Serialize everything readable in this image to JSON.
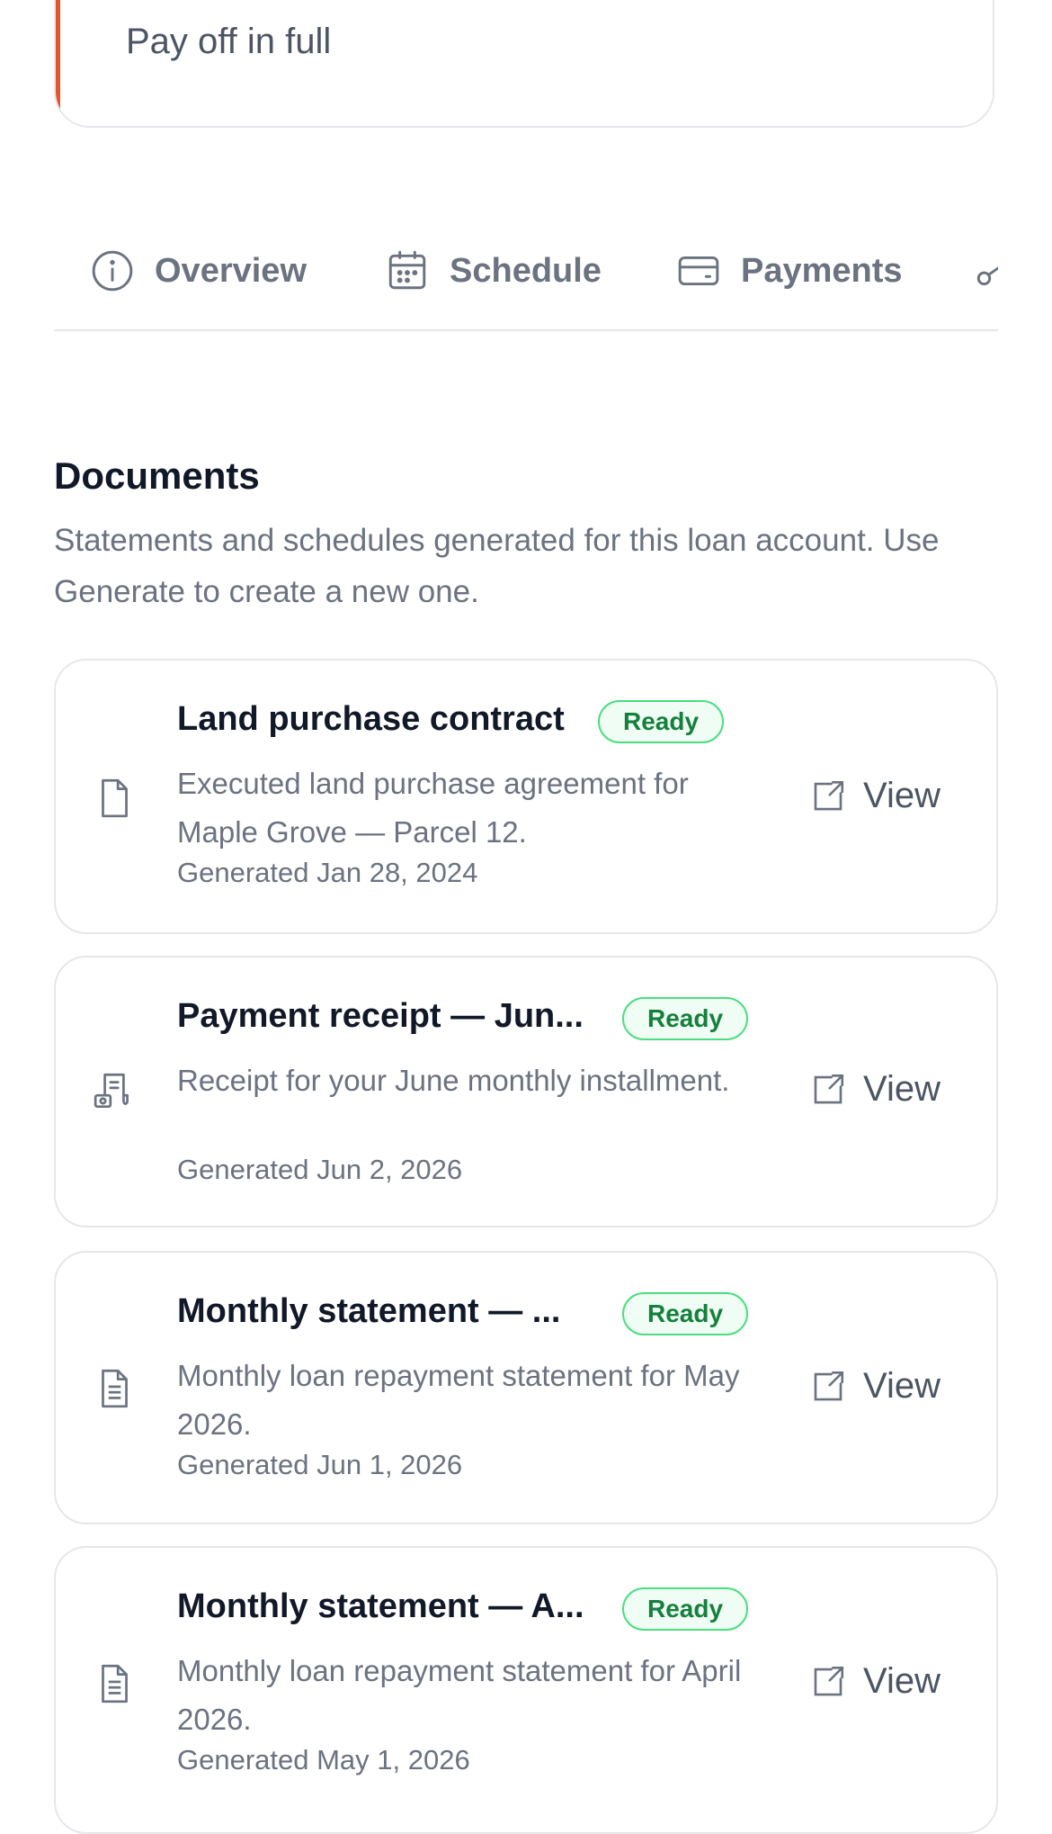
{
  "action": {
    "label": "Pay off in full",
    "accent_color": "#e8542a"
  },
  "tabs": [
    {
      "label": "Overview",
      "icon": "info-icon"
    },
    {
      "label": "Schedule",
      "icon": "calendar-icon"
    },
    {
      "label": "Payments",
      "icon": "credit-card-icon"
    },
    {
      "label": "",
      "icon": "key-icon"
    }
  ],
  "documents": {
    "title": "Documents",
    "description": "Statements and schedules generated for this loan account. Use Generate to create a new one.",
    "items": [
      {
        "title": "Land purchase contract",
        "status": "Ready",
        "description": "Executed land purchase agreement for Maple Grove — Parcel 12.",
        "generated": "Generated Jan 28, 2024",
        "icon": "file-icon",
        "action": "View"
      },
      {
        "title": "Payment receipt — Jun...",
        "status": "Ready",
        "description": "Receipt for your June monthly installment.",
        "generated": "Generated Jun 2, 2026",
        "icon": "receipt-icon",
        "action": "View"
      },
      {
        "title": "Monthly statement — ...",
        "status": "Ready",
        "description": "Monthly loan repayment statement for May 2026.",
        "generated": "Generated Jun 1, 2026",
        "icon": "file-text-icon",
        "action": "View"
      },
      {
        "title": "Monthly statement — A...",
        "status": "Ready",
        "description": "Monthly loan repayment statement for April 2026.",
        "generated": "Generated May 1, 2026",
        "icon": "file-text-icon",
        "action": "View"
      }
    ]
  },
  "colors": {
    "badge_border": "#4ade80",
    "badge_text": "#15803d",
    "muted_text": "#6b7280"
  }
}
